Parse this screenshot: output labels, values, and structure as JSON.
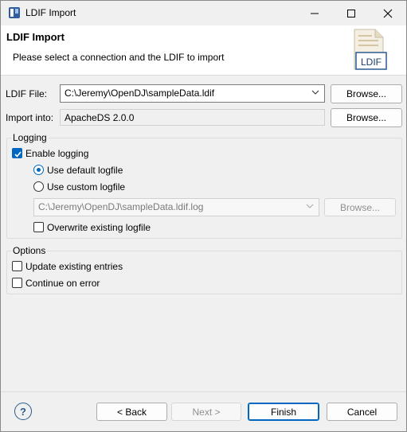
{
  "window": {
    "title": "LDIF Import",
    "controls": {
      "minimize": "—",
      "maximize": "☐",
      "close": "✕"
    }
  },
  "banner": {
    "title": "LDIF Import",
    "description": "Please select a connection and the LDIF to import",
    "art_label": "LDIF"
  },
  "form": {
    "ldif_file_label": "LDIF File:",
    "ldif_file_value": "C:\\Jeremy\\OpenDJ\\sampleData.ldif",
    "browse_label": "Browse...",
    "import_into_label": "Import into:",
    "import_into_value": "ApacheDS 2.0.0"
  },
  "logging": {
    "group_title": "Logging",
    "enable_logging": "Enable logging",
    "enable_logging_checked": true,
    "use_default": "Use default logfile",
    "use_custom": "Use custom logfile",
    "selected": "default",
    "logfile_value": "C:\\Jeremy\\OpenDJ\\sampleData.ldif.log",
    "browse_label": "Browse...",
    "overwrite": "Overwrite existing logfile",
    "overwrite_checked": false
  },
  "options": {
    "group_title": "Options",
    "update_existing": "Update existing entries",
    "update_existing_checked": false,
    "continue_on_error": "Continue on error",
    "continue_on_error_checked": false
  },
  "footer": {
    "help": "?",
    "back": "< Back",
    "next": "Next >",
    "finish": "Finish",
    "cancel": "Cancel"
  },
  "colors": {
    "accent": "#0067c0"
  }
}
